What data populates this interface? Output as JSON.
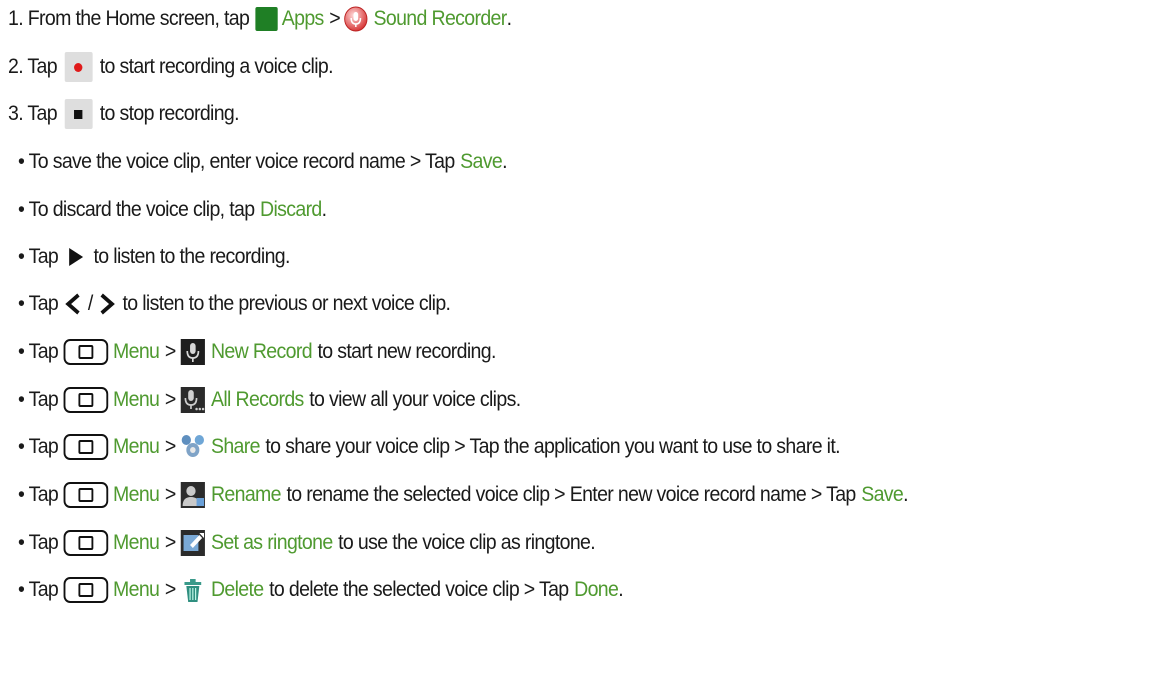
{
  "steps": {
    "s1": {
      "pre": "1. From the Home screen, tap",
      "apps": "Apps",
      "sep": ">",
      "recorder": "Sound Recorder",
      "post": "."
    },
    "s2": {
      "pre": "2. Tap",
      "post": "to start recording a voice clip."
    },
    "s3": {
      "pre": "3. Tap",
      "post": "to stop recording."
    }
  },
  "bullets": {
    "save": {
      "pre": "• To save the voice clip, enter voice record name > Tap",
      "link": "Save",
      "post": "."
    },
    "discard": {
      "pre": "• To discard the voice clip, tap",
      "link": "Discard",
      "post": "."
    },
    "play": {
      "pre": "• Tap",
      "post": "to listen to the recording."
    },
    "nav": {
      "pre": "• Tap",
      "slash": "/",
      "post": "to listen to the previous or next voice clip."
    },
    "new_record": {
      "pre": "• Tap",
      "menu": "Menu",
      "sep": ">",
      "link": "New Record",
      "post": "to start new recording."
    },
    "all_records": {
      "pre": "• Tap",
      "menu": "Menu",
      "sep": ">",
      "link": "All Records",
      "post": "to view all your voice clips."
    },
    "share": {
      "pre": "• Tap",
      "menu": "Menu",
      "sep": ">",
      "link": "Share",
      "post": "to share your voice clip > Tap the application you want to use to share it."
    },
    "rename": {
      "pre": "• Tap",
      "menu": "Menu",
      "sep": ">",
      "link": "Rename",
      "post": "to rename the selected voice clip > Enter new voice record name > Tap",
      "link2": "Save",
      "post2": "."
    },
    "ringtone": {
      "pre": "• Tap",
      "menu": "Menu",
      "sep": ">",
      "link": "Set as ringtone",
      "post": "to use the voice clip as ringtone."
    },
    "delete": {
      "pre": "• Tap",
      "menu": "Menu",
      "sep": ">",
      "link": "Delete",
      "post": "to delete the selected voice clip > Tap",
      "link2": "Done",
      "post2": "."
    }
  },
  "colors": {
    "link": "#4f9a30",
    "text": "#1a1a1a",
    "record_dot": "#e01a1a",
    "button_tile": "#dedede"
  },
  "icons": [
    "apps-grid-icon",
    "sound-recorder-icon",
    "record-icon",
    "stop-icon",
    "play-icon",
    "previous-icon",
    "next-icon",
    "menu-key-icon",
    "new-record-icon",
    "all-records-icon",
    "share-icon",
    "rename-icon",
    "set-ringtone-icon",
    "delete-icon"
  ]
}
